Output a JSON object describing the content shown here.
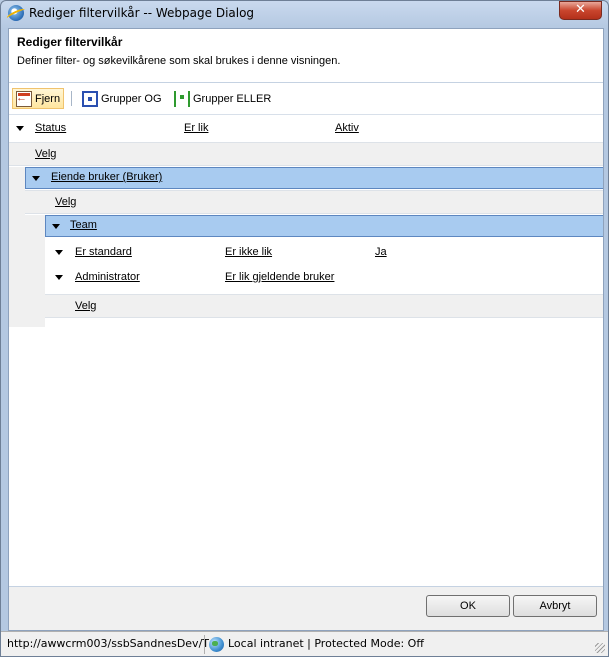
{
  "window": {
    "title": "Rediger filtervilkår -- Webpage Dialog",
    "close_label": "✕"
  },
  "header": {
    "title": "Rediger filtervilkår",
    "subtitle": "Definer filter- og søkevilkårene som skal brukes i denne visningen."
  },
  "toolbar": {
    "remove_label": "Fjern",
    "group_and_label": "Grupper OG",
    "group_or_label": "Grupper ELLER"
  },
  "conditions": {
    "row1": {
      "field": "Status",
      "operator": "Er lik",
      "value": "Aktiv"
    },
    "velg1": "Velg",
    "group1": {
      "label": "Eiende bruker (Bruker)"
    },
    "velg2": "Velg",
    "group2": {
      "label": "Team"
    },
    "row2": {
      "field": "Er standard",
      "operator": "Er ikke lik",
      "value": "Ja"
    },
    "row3": {
      "field": "Administrator",
      "operator": "Er lik gjeldende bruker",
      "value": ""
    },
    "velg3": "Velg"
  },
  "footer": {
    "ok_label": "OK",
    "cancel_label": "Avbryt"
  },
  "statusbar": {
    "url": "http://awwcrm003/ssbSandnesDev/T",
    "zone": "Local intranet | Protected Mode: Off"
  },
  "colors": {
    "group_row_bg": "#a8cbf0",
    "group_row_border": "#5d87c0",
    "velg_row_bg": "#f0f0f0"
  }
}
